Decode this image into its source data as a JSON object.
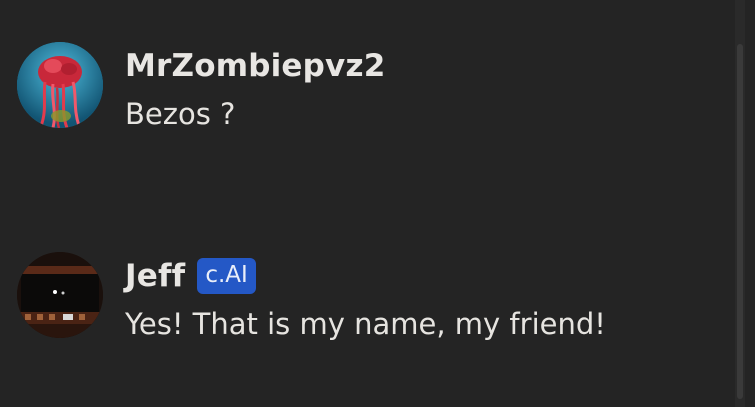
{
  "messages": [
    {
      "author": "MrZombiepvz2",
      "text": "Bezos ?",
      "avatar_icon": "zombie-plant-avatar"
    },
    {
      "author": "Jeff",
      "badge": "c.AI",
      "text": "Yes! That is my name, my friend!",
      "avatar_icon": "dark-theater-avatar"
    }
  ],
  "colors": {
    "background": "#242424",
    "text": "#e6e4e0",
    "badge": "#2458c6"
  }
}
